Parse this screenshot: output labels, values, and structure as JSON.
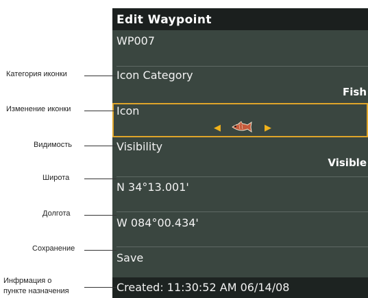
{
  "screen": {
    "title": "Edit Waypoint",
    "name_value": "WP007",
    "icon_category": {
      "label": "Icon Category",
      "value": "Fish"
    },
    "icon": {
      "label": "Icon",
      "icon_name": "fish-icon"
    },
    "visibility": {
      "label": "Visibility",
      "value": "Visible"
    },
    "latitude": "N 34°13.001'",
    "longitude": "W 084°00.434'",
    "save": "Save",
    "created": "Created: 11:30:52 AM 06/14/08"
  },
  "callouts": {
    "icon_category": "Категория иконки",
    "icon_change": "Изменение иконки",
    "visibility": "Видимость",
    "latitude": "Широта",
    "longitude": "Долгота",
    "save": "Сохранение",
    "info_line1": "Инфрмация о",
    "info_line2": "пункте назначения"
  },
  "colors": {
    "screen_bg": "#3a4640",
    "title_bg": "#1b1f1e",
    "highlight_border": "#e0a52a",
    "arrow": "#f0b21b"
  }
}
